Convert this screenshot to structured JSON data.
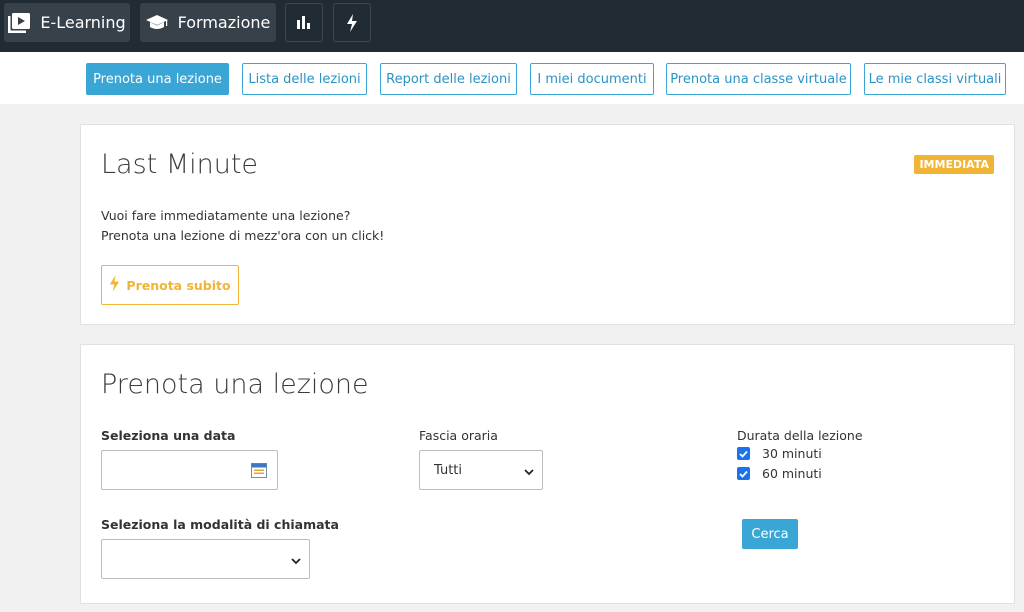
{
  "topnav": {
    "elearning_label": "E-Learning",
    "formazione_label": "Formazione"
  },
  "subnav": {
    "tabs": [
      {
        "label": "Prenota una lezione"
      },
      {
        "label": "Lista delle lezioni"
      },
      {
        "label": "Report delle lezioni"
      },
      {
        "label": "I miei documenti"
      },
      {
        "label": "Prenota una classe virtuale"
      },
      {
        "label": "Le mie classi virtuali"
      }
    ]
  },
  "last_minute": {
    "title": "Last Minute",
    "badge": "IMMEDIATA",
    "line1": "Vuoi fare immediatamente una lezione?",
    "line2": "Prenota una lezione di mezz'ora con un click!",
    "button_label": "Prenota subito"
  },
  "booking": {
    "title": "Prenota una lezione",
    "date_label": "Seleziona una data",
    "date_value": "",
    "timeslot_label": "Fascia oraria",
    "timeslot_value": "Tutti",
    "duration_label": "Durata della lezione",
    "duration_options": [
      {
        "label": "30 minuti",
        "checked": true
      },
      {
        "label": "60 minuti",
        "checked": true
      }
    ],
    "mode_label": "Seleziona la modalità di chiamata",
    "mode_value": "",
    "search_label": "Cerca"
  },
  "colors": {
    "accent": "#3aa6d6",
    "warning": "#f1b434",
    "topbar": "#212b33"
  }
}
